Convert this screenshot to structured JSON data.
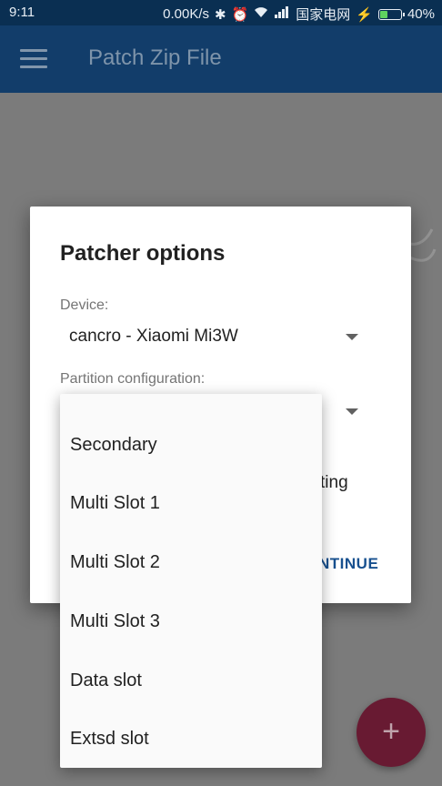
{
  "status_bar": {
    "time": "9:11",
    "network_speed": "0.00K/s",
    "carrier": "国家电网",
    "battery": "40%",
    "battery_level": 0.4,
    "icons": [
      "bluetooth-icon",
      "alarm-icon",
      "wifi-icon",
      "signal-icon",
      "charging-icon",
      "battery-icon"
    ]
  },
  "toolbar": {
    "title": "Patch Zip File",
    "menu_icon": "hamburger-menu-icon"
  },
  "dialog": {
    "title": "Patcher options",
    "device_label": "Device:",
    "device_value": "cancro - Xiaomi Mi3W",
    "partition_label": "Partition configuration:",
    "obscured_text": "ting",
    "continue_label": "NTINUE"
  },
  "dropdown": {
    "options": [
      "Secondary",
      "Multi Slot 1",
      "Multi Slot 2",
      "Multi Slot 3",
      "Data slot",
      "Extsd slot"
    ]
  },
  "fab": {
    "icon": "plus-icon",
    "label": "+"
  },
  "colors": {
    "statusbar_bg": "#0a2f52",
    "toolbar_bg": "#123d6a",
    "accent": "#17508f",
    "fab_bg": "#681a32",
    "scrim": "#7b7b7b"
  }
}
